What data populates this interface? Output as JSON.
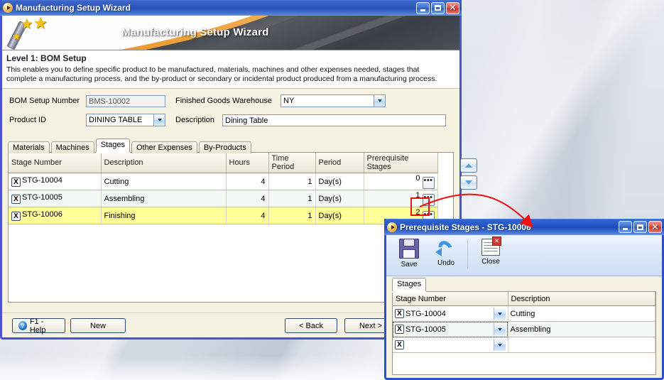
{
  "desktop": {
    "background_hint": "architectural-photo"
  },
  "main_window": {
    "title": "Manufacturing Setup Wizard",
    "title_icon": "play-circle-icon",
    "window_buttons": {
      "minimize": "_",
      "maximize": "□",
      "close": "✕"
    },
    "banner": {
      "title": "Manufacturing Setup Wizard",
      "icon": "magic-wand-icon"
    },
    "level_heading": "Level 1: BOM Setup",
    "intro_line1": "This enables you to define specific product to be manufactured, materials, machines and other expenses needed, stages that",
    "intro_line2": "complete a manufacturing process, and the by-product or secondary or incidental product produced from a manufacturing process.",
    "form": {
      "bom_setup_number_label": "BOM Setup Number",
      "bom_setup_number_value": "BMS-10002",
      "finished_goods_warehouse_label": "Finished Goods Warehouse",
      "finished_goods_warehouse_value": "NY",
      "product_id_label": "Product ID",
      "product_id_value": "DINING TABLE",
      "description_label": "Description",
      "description_value": "Dining Table"
    },
    "tabs": [
      {
        "label": "Materials",
        "active": false
      },
      {
        "label": "Machines",
        "active": false
      },
      {
        "label": "Stages",
        "active": true
      },
      {
        "label": "Other Expenses",
        "active": false
      },
      {
        "label": "By-Products",
        "active": false
      }
    ],
    "grid": {
      "columns": [
        "Stage Number",
        "Description",
        "Hours",
        "Time Period",
        "Period",
        "Prerequisite Stages"
      ],
      "rows": [
        {
          "stage_number": "STG-10004",
          "description": "Cutting",
          "hours": "4",
          "time_period": "1",
          "period": "Day(s)",
          "prerequisite_stages": "0",
          "selected": false
        },
        {
          "stage_number": "STG-10005",
          "description": "Assembling",
          "hours": "4",
          "time_period": "1",
          "period": "Day(s)",
          "prerequisite_stages": "1",
          "selected": false
        },
        {
          "stage_number": "STG-10006",
          "description": "Finishing",
          "hours": "4",
          "time_period": "1",
          "period": "Day(s)",
          "prerequisite_stages": "2",
          "selected": true
        }
      ],
      "row_delete_glyph": "X",
      "ellipsis_glyph": "•••"
    },
    "nav_buttons": {
      "up": "move-up",
      "down": "move-down"
    },
    "footer": {
      "help_label": "F1 - Help",
      "help_icon": "question-mark-icon",
      "new_label": "New",
      "back_label": "< Back",
      "next_label": "Next >"
    }
  },
  "sub_window": {
    "title": "Prerequisite Stages - STG-10006",
    "title_icon": "play-circle-icon",
    "window_buttons": {
      "minimize": "_",
      "maximize": "□",
      "close": "✕"
    },
    "toolbar": [
      {
        "label": "Save",
        "icon": "floppy-disk-icon"
      },
      {
        "label": "Undo",
        "icon": "undo-arrow-icon"
      },
      {
        "label": "Close",
        "icon": "close-window-icon"
      }
    ],
    "tabs": [
      {
        "label": "Stages",
        "active": true
      }
    ],
    "grid": {
      "columns": [
        "Stage Number",
        "Description"
      ],
      "rows": [
        {
          "stage_number": "STG-10004",
          "description": "Cutting",
          "focused": false
        },
        {
          "stage_number": "STG-10005",
          "description": "Assembling",
          "focused": true
        },
        {
          "stage_number": "",
          "description": "",
          "focused": false
        }
      ],
      "row_delete_glyph": "X"
    }
  },
  "annotations": {
    "highlight_box_target": "prerequisite-stages-ellipsis-button",
    "highlight_color": "#ee1111",
    "arrow_color": "#ee1111"
  }
}
